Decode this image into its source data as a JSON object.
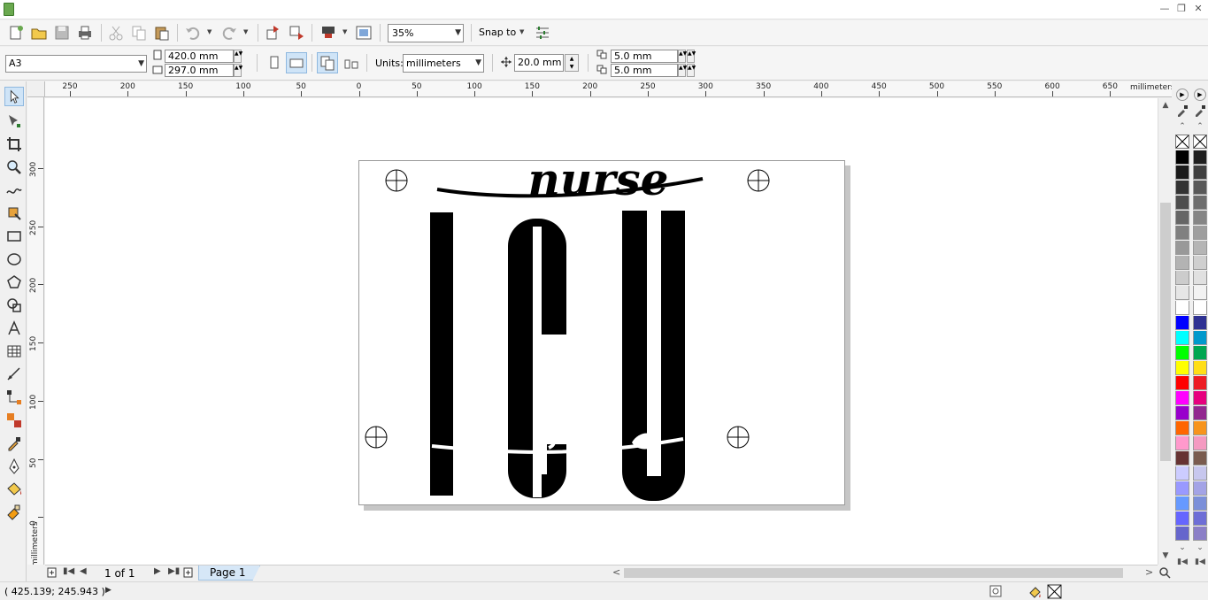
{
  "toolbar": {
    "zoom_value": "35%",
    "snap_label": "Snap to"
  },
  "property_bar": {
    "page_size": "A3",
    "width": "420.0 mm",
    "height": "297.0 mm",
    "units_label": "Units:",
    "units_value": "millimeters",
    "nudge": "20.0 mm",
    "dup_x": "5.0 mm",
    "dup_y": "5.0 mm"
  },
  "rulers": {
    "h_labels": [
      "250",
      "200",
      "150",
      "100",
      "50",
      "0",
      "50",
      "100",
      "150",
      "200",
      "250",
      "300",
      "350",
      "400",
      "450",
      "500",
      "550",
      "600",
      "650"
    ],
    "v_labels": [
      "300",
      "250",
      "200",
      "150",
      "100",
      "50",
      "0"
    ],
    "h_unit": "millimeters",
    "v_unit": "millimeters"
  },
  "artwork": {
    "script_word": "nurse",
    "block_word": "ICU"
  },
  "page_nav": {
    "position": "1 of 1",
    "tab_label": "Page 1"
  },
  "status": {
    "coordinates": "( 425.139; 245.943 )"
  },
  "palette_colors": [
    "#000000",
    "#1a1a1a",
    "#333333",
    "#4d4d4d",
    "#666666",
    "#808080",
    "#999999",
    "#b3b3b3",
    "#cccccc",
    "#e6e6e6",
    "#ffffff",
    "#0000ff",
    "#00ffff",
    "#00ff00",
    "#ffff00",
    "#ff0000",
    "#ff00ff",
    "#9900cc",
    "#ff6600",
    "#ff99cc",
    "#663333",
    "#ccccff",
    "#9999ff",
    "#6699ff",
    "#6666ff",
    "#6666cc"
  ],
  "palette2_colors": [
    "#1f1f1f",
    "#404040",
    "#595959",
    "#6e6e6e",
    "#858585",
    "#9e9e9e",
    "#b5b5b5",
    "#cfcfcf",
    "#e0e0e0",
    "#f2f2f2",
    "#ffffff",
    "#2e3192",
    "#0099cc",
    "#00a651",
    "#ffde17",
    "#ed1c24",
    "#e6007e",
    "#92278f",
    "#f7941d",
    "#f49ac1",
    "#7a5c4f",
    "#c7c7ee",
    "#a3a3e6",
    "#7b8fd9",
    "#6e6ed6",
    "#8b7fc7"
  ]
}
